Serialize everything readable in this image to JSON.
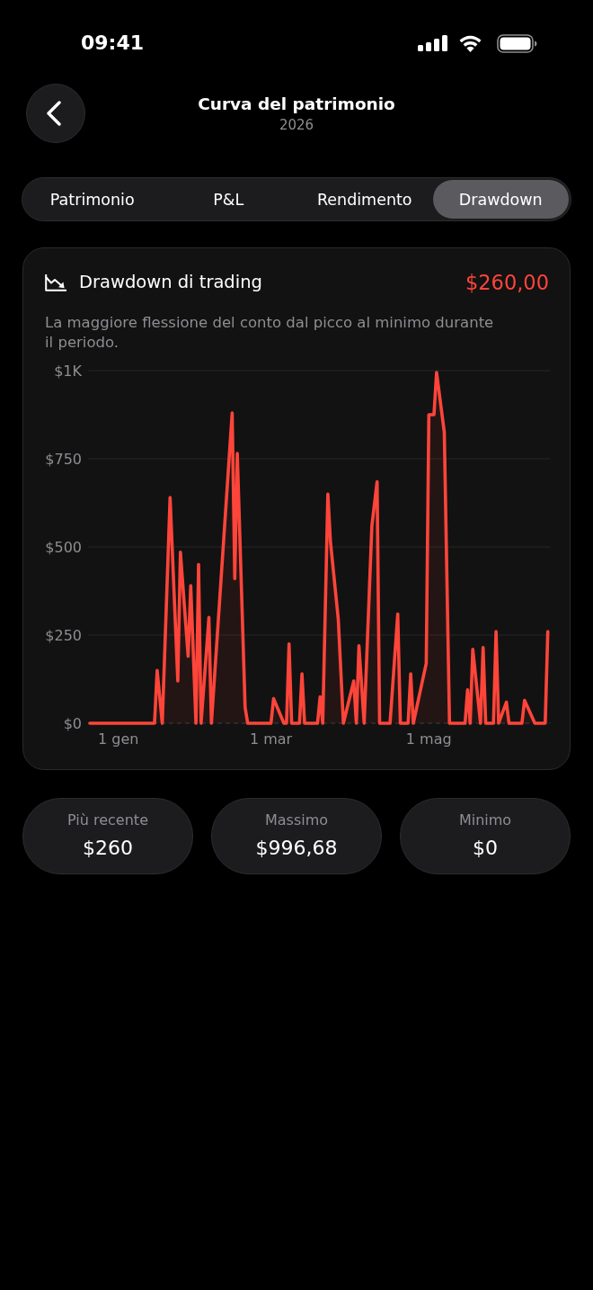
{
  "status_bar": {
    "time": "09:41"
  },
  "header": {
    "title": "Curva del patrimonio",
    "subtitle": "2026"
  },
  "tabs": [
    {
      "label": "Patrimonio",
      "selected": false
    },
    {
      "label": "P&L",
      "selected": false
    },
    {
      "label": "Rendimento",
      "selected": false
    },
    {
      "label": "Drawdown",
      "selected": true
    }
  ],
  "card": {
    "title": "Drawdown di trading",
    "value": "$260,00",
    "description": "La maggiore flessione del conto dal picco al minimo durante il periodo.",
    "chart_data": {
      "type": "area",
      "grid": true,
      "x": [
        "2025-12-21",
        "2026-01-15",
        "2026-01-16",
        "2026-01-18",
        "2026-01-21",
        "2026-01-24",
        "2026-01-25",
        "2026-01-28",
        "2026-01-29",
        "2026-01-31",
        "2026-02-01",
        "2026-02-02",
        "2026-02-05",
        "2026-02-06",
        "2026-02-14",
        "2026-02-15",
        "2026-02-16",
        "2026-02-19",
        "2026-02-20",
        "2026-03-01",
        "2026-03-02",
        "2026-03-06",
        "2026-03-07",
        "2026-03-08",
        "2026-03-09",
        "2026-03-12",
        "2026-03-13",
        "2026-03-14",
        "2026-03-19",
        "2026-03-20",
        "2026-03-21",
        "2026-03-23",
        "2026-03-24",
        "2026-03-27",
        "2026-03-29",
        "2026-04-02",
        "2026-04-03",
        "2026-04-04",
        "2026-04-06",
        "2026-04-09",
        "2026-04-11",
        "2026-04-12",
        "2026-04-16",
        "2026-04-19",
        "2026-04-20",
        "2026-04-23",
        "2026-04-24",
        "2026-04-25",
        "2026-04-30",
        "2026-05-01",
        "2026-05-03",
        "2026-05-04",
        "2026-05-07",
        "2026-05-09",
        "2026-05-15",
        "2026-05-16",
        "2026-05-17",
        "2026-05-18",
        "2026-05-21",
        "2026-05-22",
        "2026-05-23",
        "2026-05-26",
        "2026-05-27",
        "2026-05-28",
        "2026-05-31",
        "2026-06-01",
        "2026-06-06",
        "2026-06-07",
        "2026-06-11",
        "2026-06-15",
        "2026-06-16"
      ],
      "series": [
        {
          "color": "#ff453a",
          "values": [
            0,
            0,
            150,
            0,
            640,
            120,
            485,
            190,
            390,
            0,
            450,
            0,
            300,
            0,
            880,
            410,
            765,
            45,
            0,
            0,
            70,
            0,
            0,
            225,
            0,
            0,
            140,
            0,
            0,
            75,
            0,
            650,
            515,
            295,
            0,
            120,
            0,
            220,
            0,
            560,
            685,
            0,
            0,
            310,
            0,
            0,
            140,
            0,
            170,
            875,
            875,
            995,
            825,
            0,
            0,
            95,
            0,
            210,
            0,
            215,
            0,
            0,
            260,
            0,
            60,
            0,
            0,
            65,
            0,
            0,
            260
          ]
        }
      ],
      "xlim": [
        "2025-12-21",
        "2026-06-17"
      ],
      "ylim": [
        0,
        1000
      ],
      "xticks": [
        {
          "value": "2026-01-01",
          "label": "1 gen"
        },
        {
          "value": "2026-03-01",
          "label": "1 mar"
        },
        {
          "value": "2026-05-01",
          "label": "1 mag"
        }
      ],
      "yticks": [
        {
          "value": 0,
          "label": "$0"
        },
        {
          "value": 250,
          "label": "$250"
        },
        {
          "value": 500,
          "label": "$500"
        },
        {
          "value": 750,
          "label": "$750"
        },
        {
          "value": 1000,
          "label": "$1K"
        }
      ]
    }
  },
  "stats": [
    {
      "label": "Più recente",
      "value": "$260"
    },
    {
      "label": "Massimo",
      "value": "$996,68"
    },
    {
      "label": "Minimo",
      "value": "$0"
    }
  ]
}
